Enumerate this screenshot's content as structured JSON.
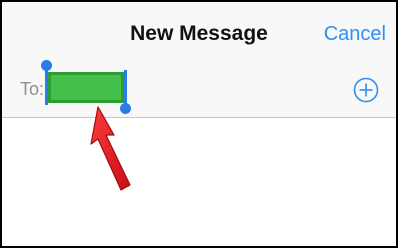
{
  "header": {
    "title": "New Message",
    "cancel_label": "Cancel"
  },
  "recipient": {
    "label": "To:",
    "value": ""
  },
  "icons": {
    "add": "plus-circle-icon",
    "annotation": "red-arrow-icon"
  },
  "colors": {
    "accent": "#2f8df4",
    "selection": "#44c04a",
    "handle": "#2a7be4",
    "annotation": "#e41b23"
  }
}
